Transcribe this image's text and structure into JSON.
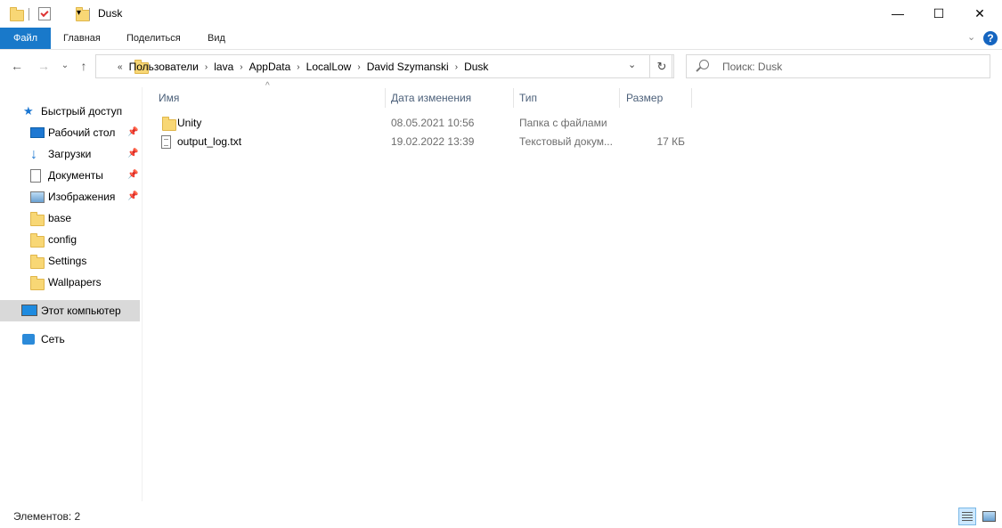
{
  "window": {
    "title": "Dusk",
    "minimize_symbol": "—",
    "maximize_symbol": "☐",
    "close_symbol": "✕"
  },
  "ribbon": {
    "tabs": [
      "Файл",
      "Главная",
      "Поделиться",
      "Вид"
    ],
    "expand_symbol": "⌄",
    "help_symbol": "?",
    "accent_color": "#1979ca"
  },
  "navigation": {
    "back_symbol": "←",
    "forward_symbol": "→",
    "recent_symbol": "⌄",
    "up_symbol": "↑"
  },
  "address": {
    "overflow": "«",
    "crumbs": [
      "Пользователи",
      "lava",
      "AppData",
      "LocalLow",
      "David Szymanski",
      "Dusk"
    ],
    "separator": "›",
    "dropdown_symbol": "⌄",
    "refresh_symbol": "↻"
  },
  "search": {
    "placeholder": "Поиск: Dusk"
  },
  "sidebar": {
    "quick_access": "Быстрый доступ",
    "items": [
      {
        "label": "Рабочий стол",
        "icon": "desktop-icon",
        "pinned": true
      },
      {
        "label": "Загрузки",
        "icon": "downloads-icon",
        "pinned": true
      },
      {
        "label": "Документы",
        "icon": "documents-icon",
        "pinned": true
      },
      {
        "label": "Изображения",
        "icon": "pictures-icon",
        "pinned": true
      },
      {
        "label": "base",
        "icon": "folder-icon",
        "pinned": false
      },
      {
        "label": "config",
        "icon": "folder-icon",
        "pinned": false
      },
      {
        "label": "Settings",
        "icon": "folder-icon",
        "pinned": false
      },
      {
        "label": "Wallpapers",
        "icon": "folder-icon",
        "pinned": false
      }
    ],
    "this_pc": "Этот компьютер",
    "network": "Сеть",
    "pin_symbol": "📌"
  },
  "columns": {
    "name": "Имя",
    "date": "Дата изменения",
    "type": "Тип",
    "size": "Размер",
    "sort_symbol": "^"
  },
  "files": [
    {
      "name": "Unity",
      "date": "08.05.2021 10:56",
      "type": "Папка с файлами",
      "size": "",
      "icon": "folder-icon"
    },
    {
      "name": "output_log.txt",
      "date": "19.02.2022 13:39",
      "type": "Текстовый докум...",
      "size": "17 КБ",
      "icon": "text-file-icon"
    }
  ],
  "status": {
    "items_count": "Элементов: 2"
  }
}
